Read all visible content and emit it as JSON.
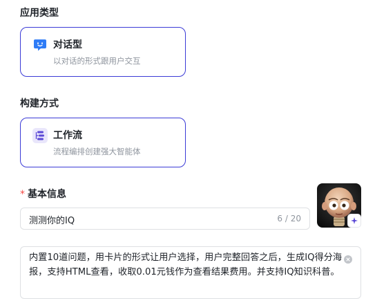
{
  "app_type": {
    "section_title": "应用类型",
    "option": {
      "title": "对话型",
      "description": "以对话的形式跟用户交互",
      "icon": "chat-bubble-icon"
    }
  },
  "build_method": {
    "section_title": "构建方式",
    "option": {
      "title": "工作流",
      "description": "流程编排创建强大智能体",
      "icon": "workflow-icon"
    }
  },
  "basic_info": {
    "required_mark": "*",
    "section_title": "基本信息",
    "name": {
      "value": "测测你的IQ",
      "counter": "6 / 20"
    },
    "description": {
      "value": "内置10道问题，用卡片的形式让用户选择，用户完整回答之后，生成IQ得分海报，支持HTML查看，收取0.01元钱作为查看结果费用。并支持IQ知识科普。"
    },
    "avatar_edit_icon": "sparkle-icon"
  },
  "colors": {
    "accent": "#3a3ad6",
    "chat_icon": "#2f7cf6",
    "workflow_icon_bg": "#e9e6fb",
    "workflow_icon": "#5b49d6",
    "required": "#f54a45"
  }
}
